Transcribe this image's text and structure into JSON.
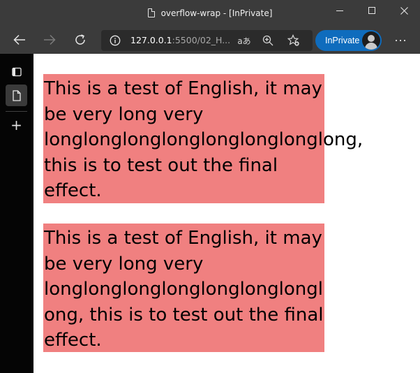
{
  "window": {
    "title": "overflow-wrap - [InPrivate]"
  },
  "toolbar": {
    "url_host": "127.0.0.1",
    "url_rest": ":5500/02_H...",
    "read_aloud_glyph": "aあ",
    "inprivate_label": "InPrivate",
    "more_glyph": "···"
  },
  "sidebar": {
    "new_tab_glyph": "+"
  },
  "page": {
    "paragraph_1": "This is a test of English, it may be very long very longlonglonglonglonglonglonglong, this is to test out the final effect.",
    "paragraph_2": "This is a test of English, it may be very long very longlonglonglonglonglonglonglong, this is to test out the final effect.",
    "box_color": "#f08080"
  },
  "colors": {
    "chrome": "#3b3b3b",
    "address_bar": "#2b2b2b",
    "inprivate_accent": "#0f6cbd",
    "sidebar": "#050505"
  }
}
